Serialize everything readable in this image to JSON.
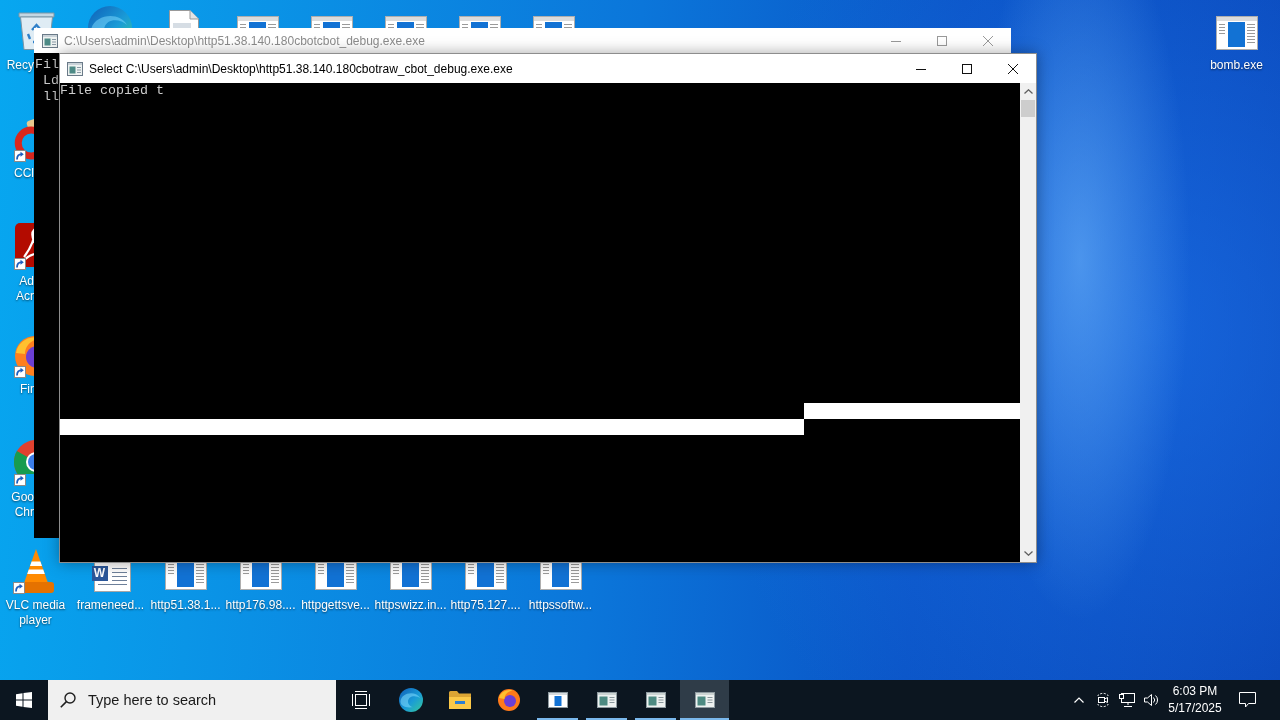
{
  "desktop": {
    "left_column": [
      {
        "kind": "recycle_bin",
        "label": "Recy",
        "shortcut": false
      },
      {
        "kind": "brush",
        "label": "CCl",
        "shortcut": true
      },
      {
        "kind": "tile",
        "label": "Ad\nAcr",
        "shortcut": true
      },
      {
        "kind": "flame_globe",
        "label": "Fir",
        "shortcut": true
      },
      {
        "kind": "segmented_circle",
        "label": "Goo\nChr",
        "shortcut": true
      }
    ],
    "top_row": [
      {
        "kind": "swirl"
      },
      {
        "kind": "document"
      },
      {
        "kind": "app"
      },
      {
        "kind": "app"
      },
      {
        "kind": "app"
      },
      {
        "kind": "app"
      },
      {
        "kind": "app"
      }
    ],
    "bottom_row": [
      {
        "kind": "cone",
        "label": "VLC media player",
        "shortcut": true
      },
      {
        "kind": "word",
        "label": "frameneed...",
        "logo_letter": "W",
        "shortcut": false
      },
      {
        "kind": "app",
        "label": "http51.38.1...",
        "shortcut": false
      },
      {
        "kind": "app",
        "label": "http176.98....",
        "shortcut": false
      },
      {
        "kind": "app",
        "label": "httpgettsve...",
        "shortcut": false
      },
      {
        "kind": "app",
        "label": "httpswizz.in...",
        "shortcut": false
      },
      {
        "kind": "app",
        "label": "http75.127....",
        "shortcut": false
      },
      {
        "kind": "app",
        "label": "httpssoftw...",
        "shortcut": false
      }
    ],
    "right_column": [
      {
        "kind": "app",
        "label": "bomb.exe",
        "shortcut": false
      }
    ]
  },
  "windows": [
    {
      "title": "C:\\Users\\admin\\Desktop\\http51.38.140.180cbotcbot_debug.exe.exe",
      "active": false,
      "lines": [
        "Fil",
        " Ld",
        " ll"
      ]
    },
    {
      "title": "Select C:\\Users\\admin\\Desktop\\http51.38.140.180cbotraw_cbot_debug.exe.exe",
      "active": true,
      "lines": [
        "File copied t"
      ],
      "text_selected": true
    }
  ],
  "taskbar": {
    "search": {
      "placeholder": "Type here to search"
    },
    "apps": [
      {
        "kind": "swirl",
        "running": false,
        "selected": false
      },
      {
        "kind": "folder",
        "running": false,
        "selected": false
      },
      {
        "kind": "flame_globe",
        "running": false,
        "selected": false
      },
      {
        "kind": "app",
        "running": true,
        "selected": false
      },
      {
        "kind": "console",
        "running": true,
        "selected": false
      },
      {
        "kind": "console",
        "running": true,
        "selected": false
      },
      {
        "kind": "console",
        "running": true,
        "selected": true
      }
    ],
    "clock": {
      "time": "6:03 PM",
      "date": "5/17/2025"
    }
  }
}
